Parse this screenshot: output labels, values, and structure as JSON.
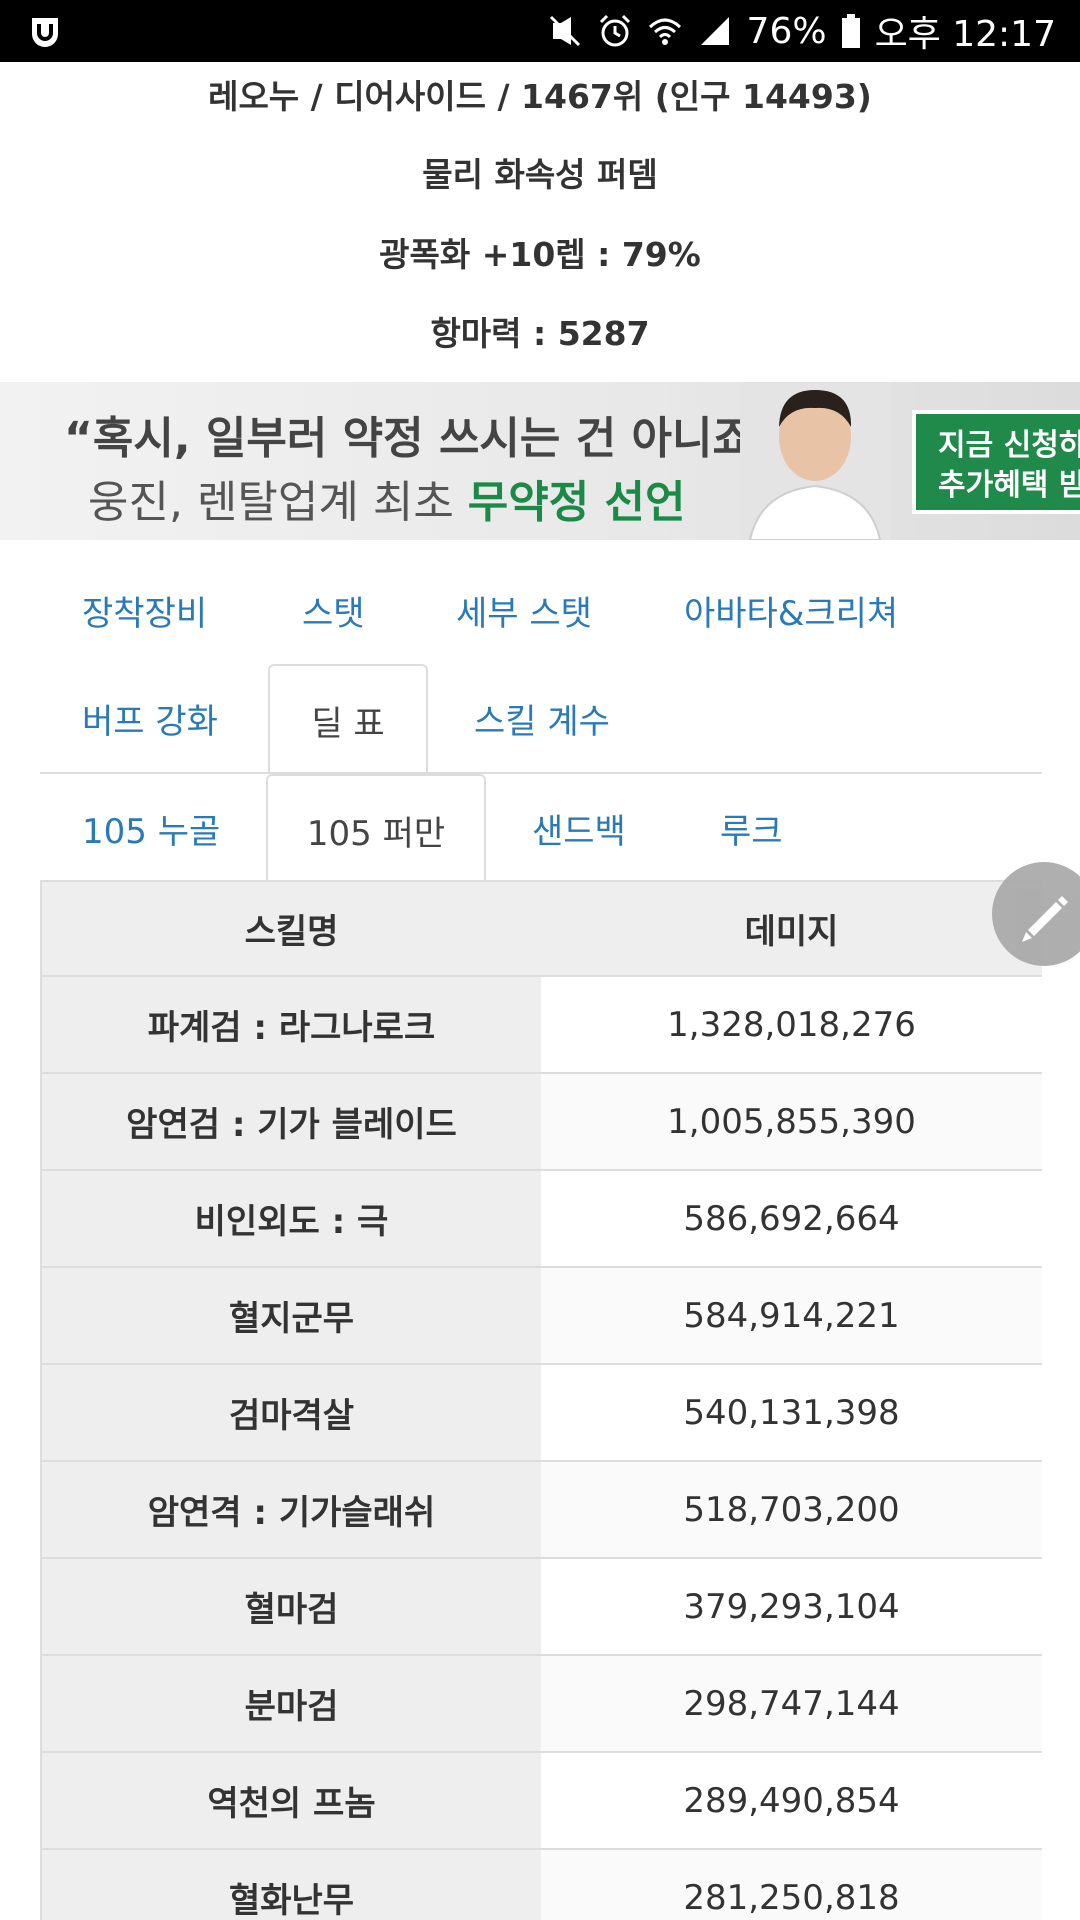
{
  "status_bar": {
    "icons": [
      "app-logo-icon",
      "mute-icon",
      "alarm-icon",
      "wifi-icon",
      "signal-icon",
      "battery-icon"
    ],
    "battery": "76%",
    "time": "오후 12:17"
  },
  "profile": {
    "summary": "레오누 / 디어사이드 / 1467위 (인구 14493)",
    "build": "물리 화속성 퍼뎀",
    "enhance": "광폭화 +10렙 : 79%",
    "magic_resist": "항마력 : 5287"
  },
  "banner": {
    "headline": "“혹시, 일부러 약정 쓰시는 건 아니죠?”",
    "sub_prefix": "웅진, 렌탈업계 최초 ",
    "sub_highlight": "무약정 선언",
    "cta_line1": "지금 신청하",
    "cta_line2": "추가혜택 받"
  },
  "tabs_main": [
    "장착장비",
    "스탯",
    "세부 스탯",
    "아바타&크리쳐",
    "버프 강화",
    "딜 표",
    "스킬 계수"
  ],
  "tabs_sub": [
    "105 누골",
    "105 퍼만",
    "샌드백",
    "루크"
  ],
  "table": {
    "headers": [
      "스킬명",
      "데미지"
    ],
    "rows": [
      [
        "파계검 : 라그나로크",
        "1,328,018,276"
      ],
      [
        "암연검 : 기가 블레이드",
        "1,005,855,390"
      ],
      [
        "비인외도 : 극",
        "586,692,664"
      ],
      [
        "혈지군무",
        "584,914,221"
      ],
      [
        "검마격살",
        "540,131,398"
      ],
      [
        "암연격 : 기가슬래쉬",
        "518,703,200"
      ],
      [
        "혈마검",
        "379,293,104"
      ],
      [
        "분마검",
        "298,747,144"
      ],
      [
        "역천의 프놈",
        "289,490,854"
      ],
      [
        "혈화난무",
        "281,250,818"
      ]
    ]
  }
}
